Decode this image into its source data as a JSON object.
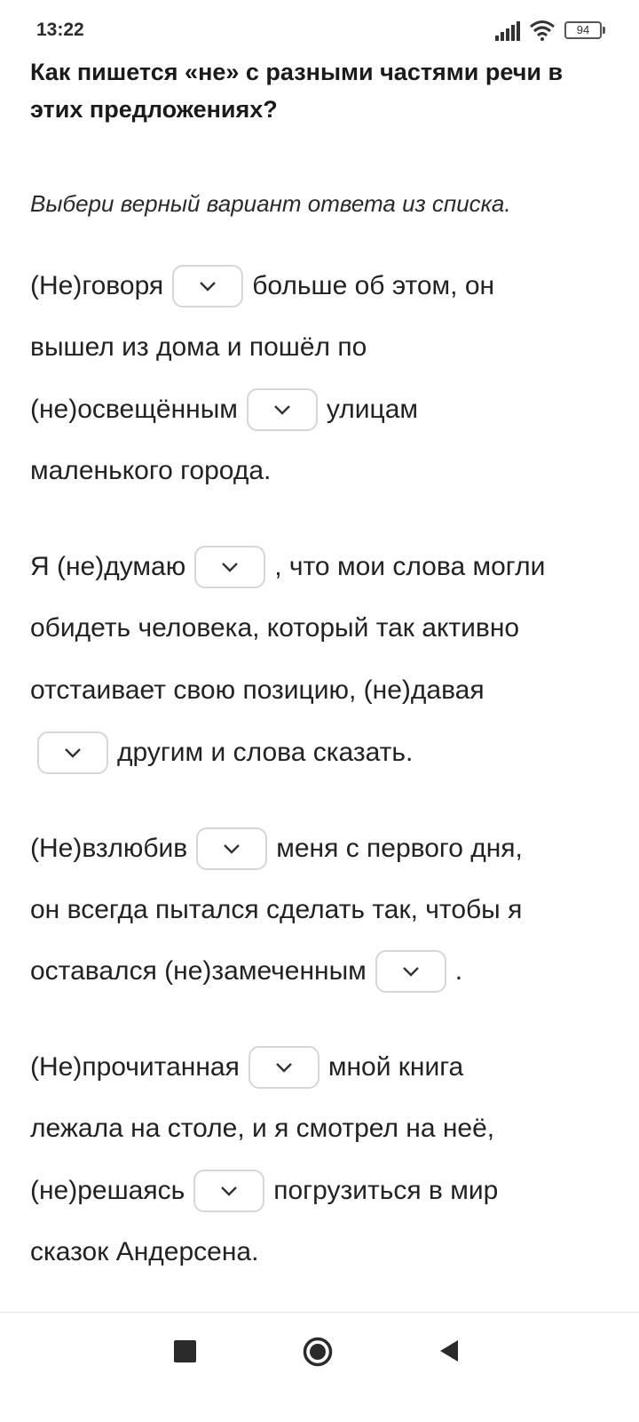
{
  "status_bar": {
    "time": "13:22",
    "battery": "94"
  },
  "question": {
    "title": "Как пишется «не» с разными частями речи в этих предложениях?",
    "instruction": "Выбери верный вариант ответа из списка."
  },
  "lines": {
    "l1a": "(Не)говоря",
    "l1b": "больше об этом, он",
    "l2": "вышел из дома и пошёл по",
    "l3a": "(не)освещённым",
    "l3b": "улицам",
    "l4": "маленького города.",
    "l5a": "Я (не)думаю",
    "l5b": ", что мои слова могли",
    "l6": "обидеть человека, который так активно",
    "l7": "отстаивает свою позицию, (не)давая",
    "l8b": "другим и слова сказать.",
    "l9a": "(Не)взлюбив",
    "l9b": "меня с первого дня,",
    "l10": "он всегда пытался сделать так, чтобы я",
    "l11a": "оставался (не)замеченным",
    "l11b": ".",
    "l12a": "(Не)прочитанная",
    "l12b": "мной книга",
    "l13": "лежала на столе, и я смотрел на неё,",
    "l14a": "(не)решаясь",
    "l14b": "погрузиться в мир",
    "l15": "сказок Андерсена."
  },
  "icons": {
    "dropdown": "chevron-down-icon",
    "signal": "signal-icon",
    "wifi": "wifi-icon",
    "battery": "battery-icon",
    "nav_recents": "square-icon",
    "nav_home": "circle-icon",
    "nav_back": "triangle-back-icon"
  }
}
